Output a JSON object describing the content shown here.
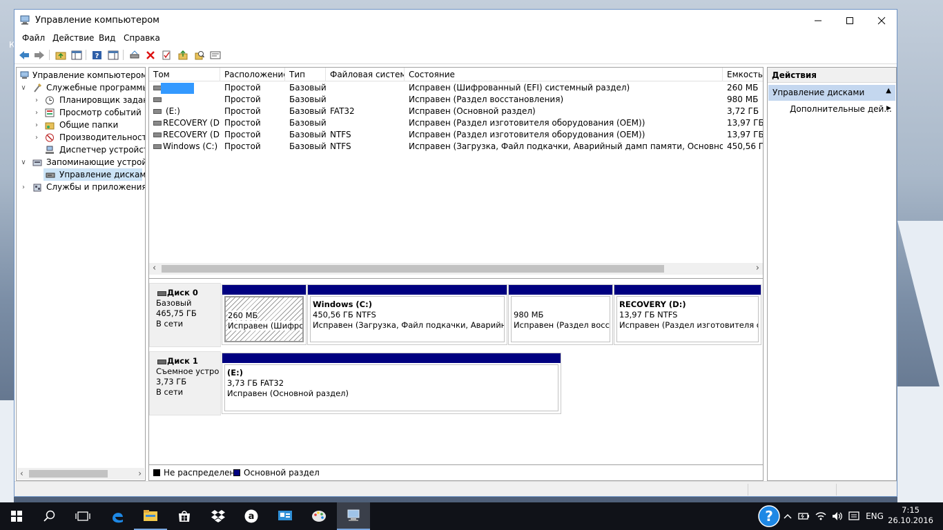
{
  "window": {
    "title": "Управление компьютером"
  },
  "desktop": {
    "edge_letter": "К"
  },
  "menu": {
    "items": [
      "Файл",
      "Действие",
      "Вид",
      "Справка"
    ]
  },
  "toolbar": {
    "icons": [
      "back-arrow-icon",
      "forward-arrow-icon",
      "up-folder-icon",
      "show-hide-tree-icon",
      "help-icon",
      "view-icon",
      "connect-drive-icon",
      "delete-icon",
      "properties-icon",
      "export-icon",
      "search-icon",
      "disk-icon"
    ]
  },
  "tree": {
    "root": "Управление компьютером (л",
    "system_tools": "Служебные программы",
    "task_scheduler": "Планировщик заданий",
    "event_viewer": "Просмотр событий",
    "shared_folders": "Общие папки",
    "performance": "Производительность",
    "device_manager": "Диспетчер устройств",
    "storage": "Запоминающие устройст",
    "disk_management": "Управление дисками",
    "services_apps": "Службы и приложения"
  },
  "volumes": {
    "columns": [
      "Том",
      "Расположение",
      "Тип",
      "Файловая система",
      "Состояние",
      "Емкость"
    ],
    "rows": [
      {
        "name": "",
        "layout": "Простой",
        "type": "Базовый",
        "fs": "",
        "status": "Исправен (Шифрованный (EFI) системный раздел)",
        "capacity": "260 МБ"
      },
      {
        "name": "",
        "layout": "Простой",
        "type": "Базовый",
        "fs": "",
        "status": "Исправен (Раздел восстановления)",
        "capacity": "980 МБ"
      },
      {
        "name": "(E:)",
        "layout": "Простой",
        "type": "Базовый",
        "fs": "FAT32",
        "status": "Исправен (Основной раздел)",
        "capacity": "3,72 ГБ"
      },
      {
        "name": "RECOVERY (D:)",
        "layout": "Простой",
        "type": "Базовый",
        "fs": "",
        "status": "Исправен (Раздел изготовителя оборудования (OEM))",
        "capacity": "13,97 ГБ"
      },
      {
        "name": "RECOVERY (D:)",
        "layout": "Простой",
        "type": "Базовый",
        "fs": "NTFS",
        "status": "Исправен (Раздел изготовителя оборудования (OEM))",
        "capacity": "13,97 ГБ"
      },
      {
        "name": "Windows (C:)",
        "layout": "Простой",
        "type": "Базовый",
        "fs": "NTFS",
        "status": "Исправен (Загрузка, Файл подкачки, Аварийный дамп памяти, Основной раздел)",
        "capacity": "450,56 ГБ"
      }
    ]
  },
  "disks": [
    {
      "name": "Диск 0",
      "kind": "Базовый",
      "size": "465,75 ГБ",
      "state": "В сети",
      "partitions": [
        {
          "title": "",
          "line1": "260 МБ",
          "line2": "Исправен (Шифров"
        },
        {
          "title": "Windows  (C:)",
          "line1": "450,56 ГБ NTFS",
          "line2": "Исправен (Загрузка, Файл подкачки, Аварийный д"
        },
        {
          "title": "",
          "line1": "980 МБ",
          "line2": "Исправен (Раздел восста"
        },
        {
          "title": "RECOVERY  (D:)",
          "line1": "13,97 ГБ NTFS",
          "line2": "Исправен (Раздел изготовителя обо"
        }
      ]
    },
    {
      "name": "Диск 1",
      "kind": "Съемное устро",
      "size": "3,73 ГБ",
      "state": "В сети",
      "partitions": [
        {
          "title": "(E:)",
          "line1": "3,73 ГБ FAT32",
          "line2": "Исправен (Основной раздел)"
        }
      ]
    }
  ],
  "legend": {
    "unallocated": "Не распределена",
    "primary": "Основной раздел"
  },
  "colors": {
    "primary_partition": "#000080",
    "selection_highlight": "#3399ff",
    "actions_section": "#c4d7ef"
  },
  "actions": {
    "header": "Действия",
    "section": "Управление дисками",
    "more": "Дополнительные дей..."
  },
  "taskbar": {
    "icons": [
      "start-icon",
      "search-icon",
      "task-view-icon",
      "edge-icon",
      "file-explorer-icon",
      "store-icon",
      "dropbox-icon",
      "amazon-icon",
      "control-panel-icon",
      "paint-icon",
      "computer-management-icon"
    ],
    "tray": [
      "help-icon",
      "chevron-up-icon",
      "power-icon",
      "wifi-icon",
      "volume-icon",
      "notifications-icon"
    ],
    "lang": "ENG",
    "time": "7:15",
    "date": "26.10.2016"
  }
}
